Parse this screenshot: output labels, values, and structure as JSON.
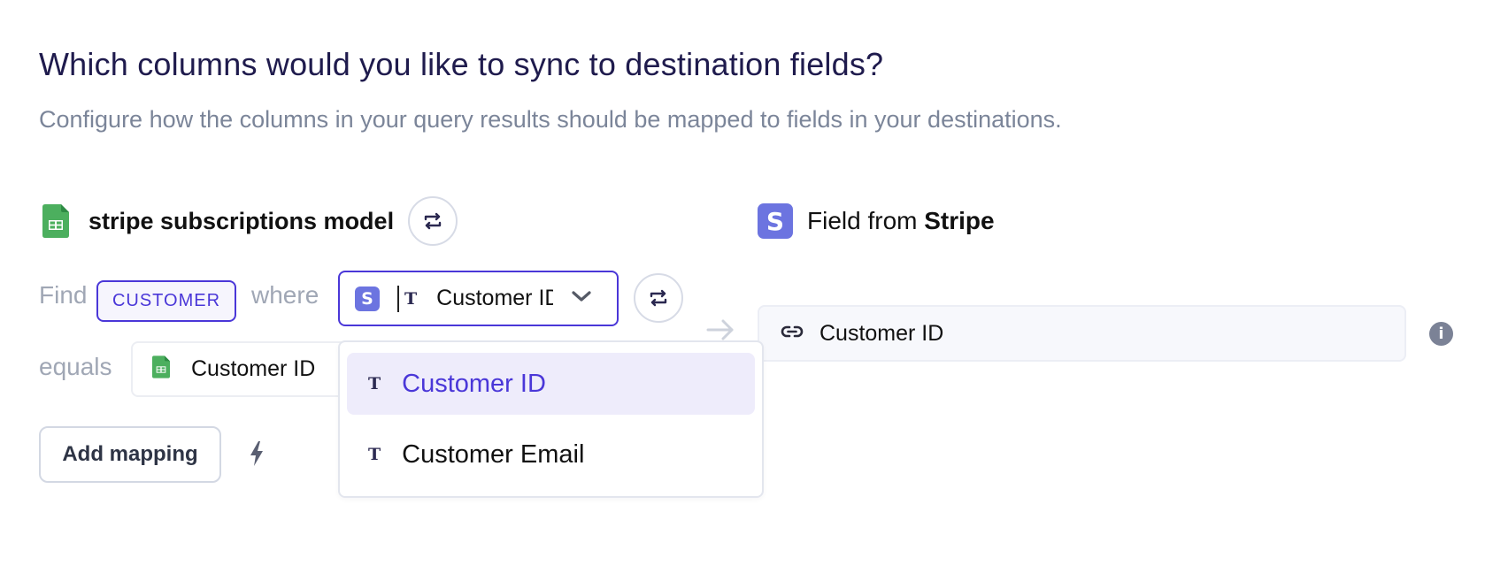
{
  "header": {
    "title": "Which columns would you like to sync to destination fields?",
    "subtitle": "Configure how the columns in your query results should be mapped to fields in your destinations."
  },
  "source": {
    "icon": "google-sheets-icon",
    "name": "stripe subscriptions model",
    "swap_icon": "swap-icon"
  },
  "destination": {
    "icon": "stripe-logo",
    "logo_letter": "S",
    "label_prefix": "Field from",
    "label_bold": "Stripe"
  },
  "match": {
    "find_label": "Find",
    "entity": "CUSTOMER",
    "where_label": "where",
    "select": {
      "logo_letter": "S",
      "type_icon": "T",
      "value": "Customer ID"
    },
    "equals_label": "equals",
    "equals_value": "Customer ID"
  },
  "dropdown": {
    "options": [
      {
        "type_icon": "T",
        "label": "Customer ID",
        "active": true
      },
      {
        "type_icon": "T",
        "label": "Customer Email",
        "active": false
      }
    ]
  },
  "destination_field": {
    "icon": "link-icon",
    "value": "Customer ID",
    "info_glyph": "i"
  },
  "actions": {
    "add_mapping": "Add mapping",
    "bolt_icon": "lightning-icon"
  },
  "colors": {
    "accent": "#4a37d8",
    "stripe": "#6c74e0",
    "sheets": "#4caf5e",
    "title": "#1f1b4d",
    "muted": "#7b8599"
  }
}
